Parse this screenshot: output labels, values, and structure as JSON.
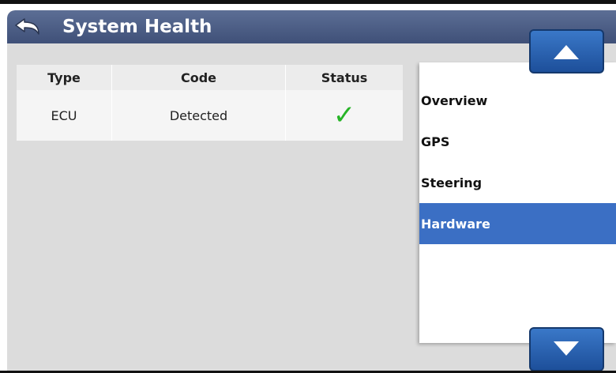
{
  "window": {
    "title": "System Health",
    "back_icon": "back-arrow-icon"
  },
  "table": {
    "columns": [
      "Type",
      "Code",
      "Status"
    ],
    "rows": [
      {
        "type": "ECU",
        "code": "Detected",
        "status_icon": "checkmark-icon",
        "status_glyph": "✓"
      }
    ]
  },
  "sidebar": {
    "items": [
      {
        "label": "Overview",
        "selected": false
      },
      {
        "label": "GPS",
        "selected": false
      },
      {
        "label": "Steering",
        "selected": false
      },
      {
        "label": "Hardware",
        "selected": true
      }
    ]
  },
  "scroll": {
    "up_icon": "triangle-up-icon",
    "down_icon": "triangle-down-icon"
  },
  "colors": {
    "titlebar": "#4a5b85",
    "selected": "#3b6fc4",
    "check": "#27b427",
    "button": "#2a65b5"
  }
}
